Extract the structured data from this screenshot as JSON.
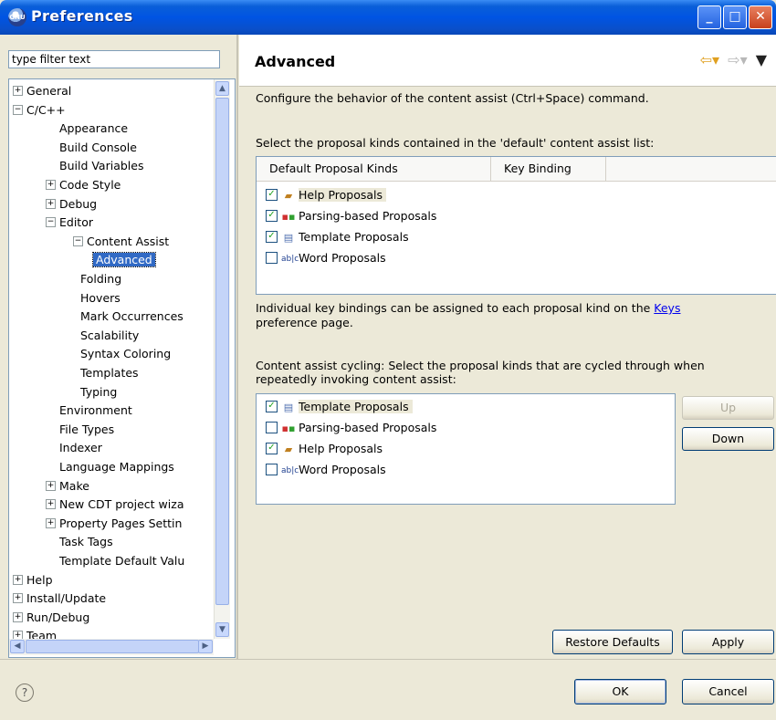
{
  "window": {
    "title": "Preferences",
    "app_icon_text": "GNU"
  },
  "titlebar_buttons": {
    "minimize": "_",
    "maximize": "□",
    "close": "✕"
  },
  "filter": {
    "value": "type filter text"
  },
  "tree": [
    {
      "label": "General",
      "expander": "+"
    },
    {
      "label": "C/C++",
      "expander": "−"
    },
    {
      "label": "Appearance"
    },
    {
      "label": "Build Console"
    },
    {
      "label": "Build Variables"
    },
    {
      "label": "Code Style",
      "expander": "+"
    },
    {
      "label": "Debug",
      "expander": "+"
    },
    {
      "label": "Editor",
      "expander": "−"
    },
    {
      "label": "Content Assist",
      "expander": "−"
    },
    {
      "label": "Advanced",
      "selected": true
    },
    {
      "label": "Folding"
    },
    {
      "label": "Hovers"
    },
    {
      "label": "Mark Occurrences"
    },
    {
      "label": "Scalability"
    },
    {
      "label": "Syntax Coloring"
    },
    {
      "label": "Templates"
    },
    {
      "label": "Typing"
    },
    {
      "label": "Environment"
    },
    {
      "label": "File Types"
    },
    {
      "label": "Indexer"
    },
    {
      "label": "Language Mappings"
    },
    {
      "label": "Make",
      "expander": "+"
    },
    {
      "label": "New CDT project wiza",
      "expander": "+"
    },
    {
      "label": "Property Pages Settin",
      "expander": "+"
    },
    {
      "label": "Task Tags"
    },
    {
      "label": "Template Default Valu"
    },
    {
      "label": "Help",
      "expander": "+"
    },
    {
      "label": "Install/Update",
      "expander": "+"
    },
    {
      "label": "Run/Debug",
      "expander": "+"
    },
    {
      "label": "Team",
      "expander": "+"
    }
  ],
  "page": {
    "title": "Advanced",
    "description": "Configure the behavior of the content assist (Ctrl+Space) command.",
    "default_list_label": "Select the proposal kinds contained in the 'default' content assist list:",
    "columns": [
      "Default Proposal Kinds",
      "Key Binding"
    ],
    "default_items": [
      {
        "label": "Help Proposals",
        "checked": true,
        "icon": "help-proposals-icon",
        "highlighted": true
      },
      {
        "label": "Parsing-based Proposals",
        "checked": true,
        "icon": "parsing-proposals-icon"
      },
      {
        "label": "Template Proposals",
        "checked": true,
        "icon": "template-proposals-icon"
      },
      {
        "label": "Word Proposals",
        "checked": false,
        "icon": "word-proposals-icon"
      }
    ],
    "key_note_prefix": "Individual key bindings can be assigned to each proposal kind on the",
    "key_note_link": "Keys",
    "key_note_suffix": "preference page.",
    "cycling_label_1": "Content assist cycling: Select the proposal kinds that are cycled through when",
    "cycling_label_2": "repeatedly invoking content assist:",
    "cycling_items": [
      {
        "label": "Template Proposals",
        "checked": true,
        "icon": "template-proposals-icon",
        "highlighted": true
      },
      {
        "label": "Parsing-based Proposals",
        "checked": false,
        "icon": "parsing-proposals-icon"
      },
      {
        "label": "Help Proposals",
        "checked": true,
        "icon": "help-proposals-icon"
      },
      {
        "label": "Word Proposals",
        "checked": false,
        "icon": "word-proposals-icon"
      }
    ],
    "up_button": "Up",
    "down_button": "Down",
    "restore_defaults": "Restore Defaults",
    "apply": "Apply"
  },
  "footer": {
    "help": "?",
    "ok": "OK",
    "cancel": "Cancel"
  },
  "colors": {
    "title_bar": "#0054e3",
    "selection": "#316ac5",
    "link": "#0000ee",
    "check": "#21a121"
  }
}
